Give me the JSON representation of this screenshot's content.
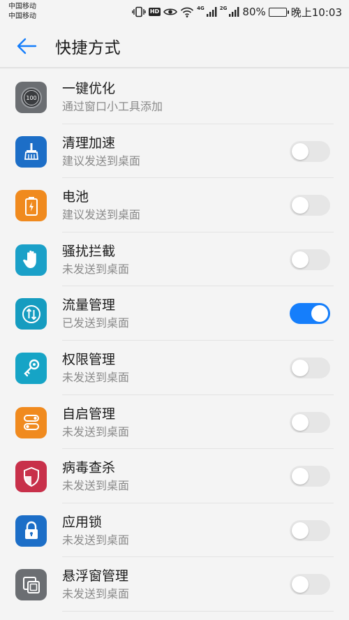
{
  "status_bar": {
    "carrier_1": "中国移动",
    "carrier_2": "中国移动",
    "hd": "HD",
    "net_1": "4G",
    "net_2": "2G",
    "battery_pct": "80%",
    "battery_level": 0.8,
    "time": "晚上10:03"
  },
  "header": {
    "title": "快捷方式"
  },
  "colors": {
    "accent": "#157efb",
    "toggle_off": "#e6e6e6"
  },
  "items": [
    {
      "title": "一键优化",
      "subtitle": "通过窗口小工具添加",
      "icon": "speed-meter-icon",
      "icon_color": "#6b6e72",
      "toggle": null
    },
    {
      "title": "清理加速",
      "subtitle": "建议发送到桌面",
      "icon": "broom-icon",
      "icon_color": "#1c6ec7",
      "toggle": false
    },
    {
      "title": "电池",
      "subtitle": "建议发送到桌面",
      "icon": "battery-icon",
      "icon_color": "#f08a1e",
      "toggle": false
    },
    {
      "title": "骚扰拦截",
      "subtitle": "未发送到桌面",
      "icon": "hand-icon",
      "icon_color": "#1aa0c8",
      "toggle": false
    },
    {
      "title": "流量管理",
      "subtitle": "已发送到桌面",
      "icon": "data-traffic-icon",
      "icon_color": "#159cc0",
      "toggle": true
    },
    {
      "title": "权限管理",
      "subtitle": "未发送到桌面",
      "icon": "key-icon",
      "icon_color": "#16a4c6",
      "toggle": false
    },
    {
      "title": "自启管理",
      "subtitle": "未发送到桌面",
      "icon": "startup-icon",
      "icon_color": "#f08a1e",
      "toggle": false
    },
    {
      "title": "病毒查杀",
      "subtitle": "未发送到桌面",
      "icon": "shield-icon",
      "icon_color": "#c8304a",
      "toggle": false
    },
    {
      "title": "应用锁",
      "subtitle": "未发送到桌面",
      "icon": "lock-icon",
      "icon_color": "#1c6ec7",
      "toggle": false
    },
    {
      "title": "悬浮窗管理",
      "subtitle": "未发送到桌面",
      "icon": "floating-window-icon",
      "icon_color": "#6b6e72",
      "toggle": false
    }
  ]
}
